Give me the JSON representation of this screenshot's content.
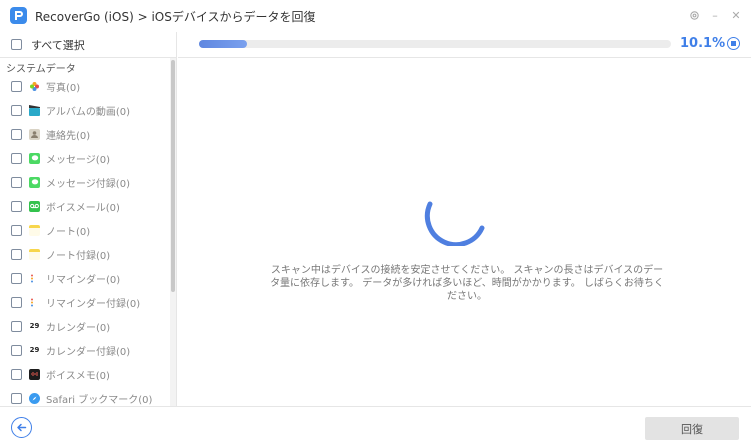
{
  "app": {
    "title": "RecoverGo (iOS) > iOSデバイスからデータを回復"
  },
  "window_controls": {
    "settings_icon": "gear-icon",
    "minimize_glyph": "–",
    "close_glyph": "✕"
  },
  "sidebar": {
    "select_all_label": "すべて選択",
    "section_label": "システムデータ",
    "items": [
      {
        "label": "写真(0)",
        "icon": "photos-icon",
        "color": "#f5a623"
      },
      {
        "label": "アルバムの動画(0)",
        "icon": "clapper-icon",
        "color": "#2aa9c9"
      },
      {
        "label": "連絡先(0)",
        "icon": "contacts-icon",
        "color": "#d9d3c5"
      },
      {
        "label": "メッセージ(0)",
        "icon": "messages-icon",
        "color": "#4cd964"
      },
      {
        "label": "メッセージ付録(0)",
        "icon": "messages-attachment-icon",
        "color": "#4cd964"
      },
      {
        "label": "ボイスメール(0)",
        "icon": "voicemail-icon",
        "color": "#33c24d"
      },
      {
        "label": "ノート(0)",
        "icon": "notes-icon",
        "color": "#f7d64c"
      },
      {
        "label": "ノート付録(0)",
        "icon": "notes-attachment-icon",
        "color": "#f7d64c"
      },
      {
        "label": "リマインダー(0)",
        "icon": "reminders-icon",
        "color": "#e85a4f"
      },
      {
        "label": "リマインダー付録(0)",
        "icon": "reminders-attachment-icon",
        "color": "#e85a4f"
      },
      {
        "label": "カレンダー(0)",
        "icon": "calendar-icon",
        "color": "#ffffff",
        "glyph": "29"
      },
      {
        "label": "カレンダー付録(0)",
        "icon": "calendar-attachment-icon",
        "color": "#ffffff",
        "glyph": "29"
      },
      {
        "label": "ボイスメモ(0)",
        "icon": "voice-memo-icon",
        "color": "#1c1c1c"
      },
      {
        "label": "Safari ブックマーク(0)",
        "icon": "safari-icon",
        "color": "#3a9bf0"
      }
    ]
  },
  "scan": {
    "progress_fraction": 0.101,
    "progress_text": "10.1%",
    "message": "スキャン中はデバイスの接続を安定させてください。 スキャンの長さはデバイスのデータ量に依存します。 データが多ければ多いほど、時間がかかります。 しばらくお待ちください。",
    "accent_color": "#3f7fe8"
  },
  "footer": {
    "recover_label": "回復"
  }
}
